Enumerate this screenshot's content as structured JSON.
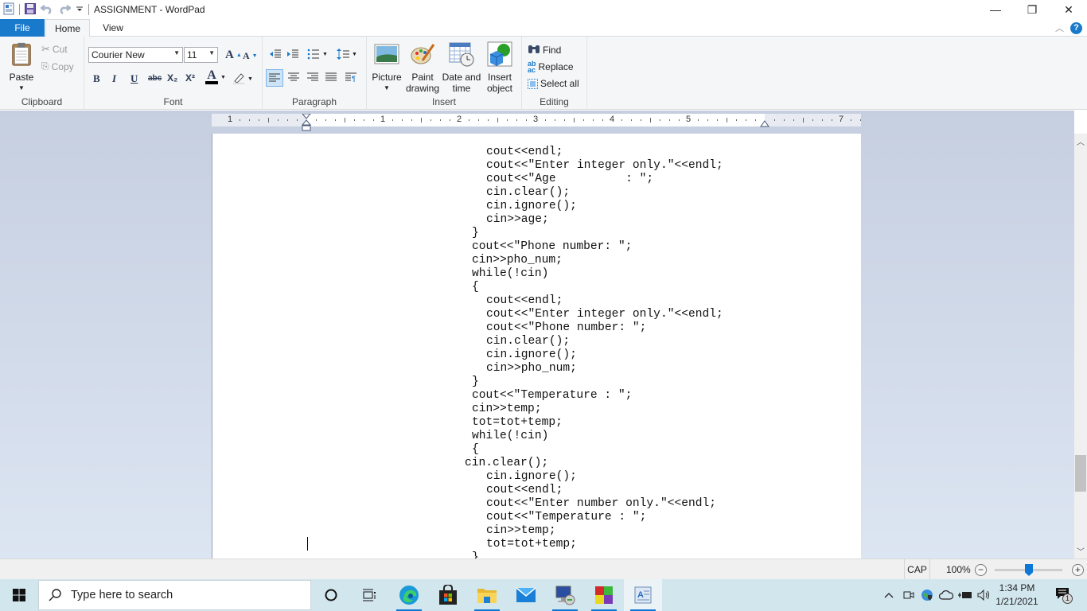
{
  "window": {
    "title": "ASSIGNMENT - WordPad",
    "controls": {
      "minimize": "—",
      "restore": "❐",
      "close": "✕"
    }
  },
  "tabs": [
    {
      "label": "File",
      "active": false
    },
    {
      "label": "Home",
      "active": true
    },
    {
      "label": "View",
      "active": false
    }
  ],
  "ribbon": {
    "clipboard": {
      "label": "Clipboard",
      "paste": "Paste",
      "cut": "Cut",
      "copy": "Copy"
    },
    "font": {
      "label": "Font",
      "family": "Courier New",
      "size": "11",
      "bold": "B",
      "italic": "I",
      "underline": "U",
      "strike": "abc",
      "subscript": "X₂",
      "superscript": "X²",
      "font_color_glyph": "A",
      "grow": "A",
      "shrink": "A"
    },
    "paragraph": {
      "label": "Paragraph"
    },
    "insert": {
      "label": "Insert",
      "picture": "Picture",
      "paint_drawing": [
        "Paint",
        "drawing"
      ],
      "date_time": [
        "Date and",
        "time"
      ],
      "insert_object": [
        "Insert",
        "object"
      ]
    },
    "editing": {
      "label": "Editing",
      "find": "Find",
      "replace": "Replace",
      "select_all": "Select all"
    }
  },
  "ruler": {
    "numbers": [
      "1",
      "1",
      "2",
      "3",
      "4",
      "5",
      "7"
    ]
  },
  "document": {
    "lines": [
      {
        "indent": 6,
        "text": "cout<<endl;"
      },
      {
        "indent": 6,
        "text": "cout<<\"Enter integer only.\"<<endl;"
      },
      {
        "indent": 6,
        "text": "cout<<\"Age          : \";"
      },
      {
        "indent": 6,
        "text": "cin.clear();"
      },
      {
        "indent": 6,
        "text": "cin.ignore();"
      },
      {
        "indent": 6,
        "text": "cin>>age;"
      },
      {
        "indent": 4,
        "text": "}"
      },
      {
        "indent": 4,
        "text": "cout<<\"Phone number: \";"
      },
      {
        "indent": 4,
        "text": "cin>>pho_num;"
      },
      {
        "indent": 4,
        "text": "while(!cin)"
      },
      {
        "indent": 4,
        "text": "{"
      },
      {
        "indent": 6,
        "text": "cout<<endl;"
      },
      {
        "indent": 6,
        "text": "cout<<\"Enter integer only.\"<<endl;"
      },
      {
        "indent": 6,
        "text": "cout<<\"Phone number: \";"
      },
      {
        "indent": 6,
        "text": "cin.clear();"
      },
      {
        "indent": 6,
        "text": "cin.ignore();"
      },
      {
        "indent": 6,
        "text": "cin>>pho_num;"
      },
      {
        "indent": 4,
        "text": "}"
      },
      {
        "indent": 4,
        "text": "cout<<\"Temperature : \";"
      },
      {
        "indent": 4,
        "text": "cin>>temp;"
      },
      {
        "indent": 4,
        "text": "tot=tot+temp;"
      },
      {
        "indent": 4,
        "text": "while(!cin)"
      },
      {
        "indent": 4,
        "text": "{"
      },
      {
        "indent": 3,
        "text": "cin.clear();"
      },
      {
        "indent": 6,
        "text": "cin.ignore();"
      },
      {
        "indent": 6,
        "text": "cout<<endl;"
      },
      {
        "indent": 6,
        "text": "cout<<\"Enter number only.\"<<endl;"
      },
      {
        "indent": 6,
        "text": "cout<<\"Temperature : \";"
      },
      {
        "indent": 6,
        "text": "cin>>temp;"
      },
      {
        "indent": 6,
        "text": "tot=tot+temp;"
      },
      {
        "indent": 4,
        "text": "}"
      }
    ]
  },
  "statusbar": {
    "caps": "CAP",
    "zoom": "100%",
    "zoom_minus": "−",
    "zoom_plus": "+",
    "zoom_level_fraction": 0.5
  },
  "taskbar": {
    "search_placeholder": "Type here to search",
    "apps": [
      "Cortana",
      "Task View",
      "Microsoft Edge",
      "Microsoft Store",
      "File Explorer",
      "Mail",
      "Remote Desktop",
      "Color App",
      "WordPad"
    ],
    "clock_time": "1:34 PM",
    "clock_date": "1/21/2021",
    "notifications_count": "1"
  },
  "colors": {
    "accent": "#1979ca",
    "ribbon_bg": "#f5f6f7",
    "workspace_bg": "#c6cfe0",
    "taskbar_bg": "#d2e6ee"
  }
}
